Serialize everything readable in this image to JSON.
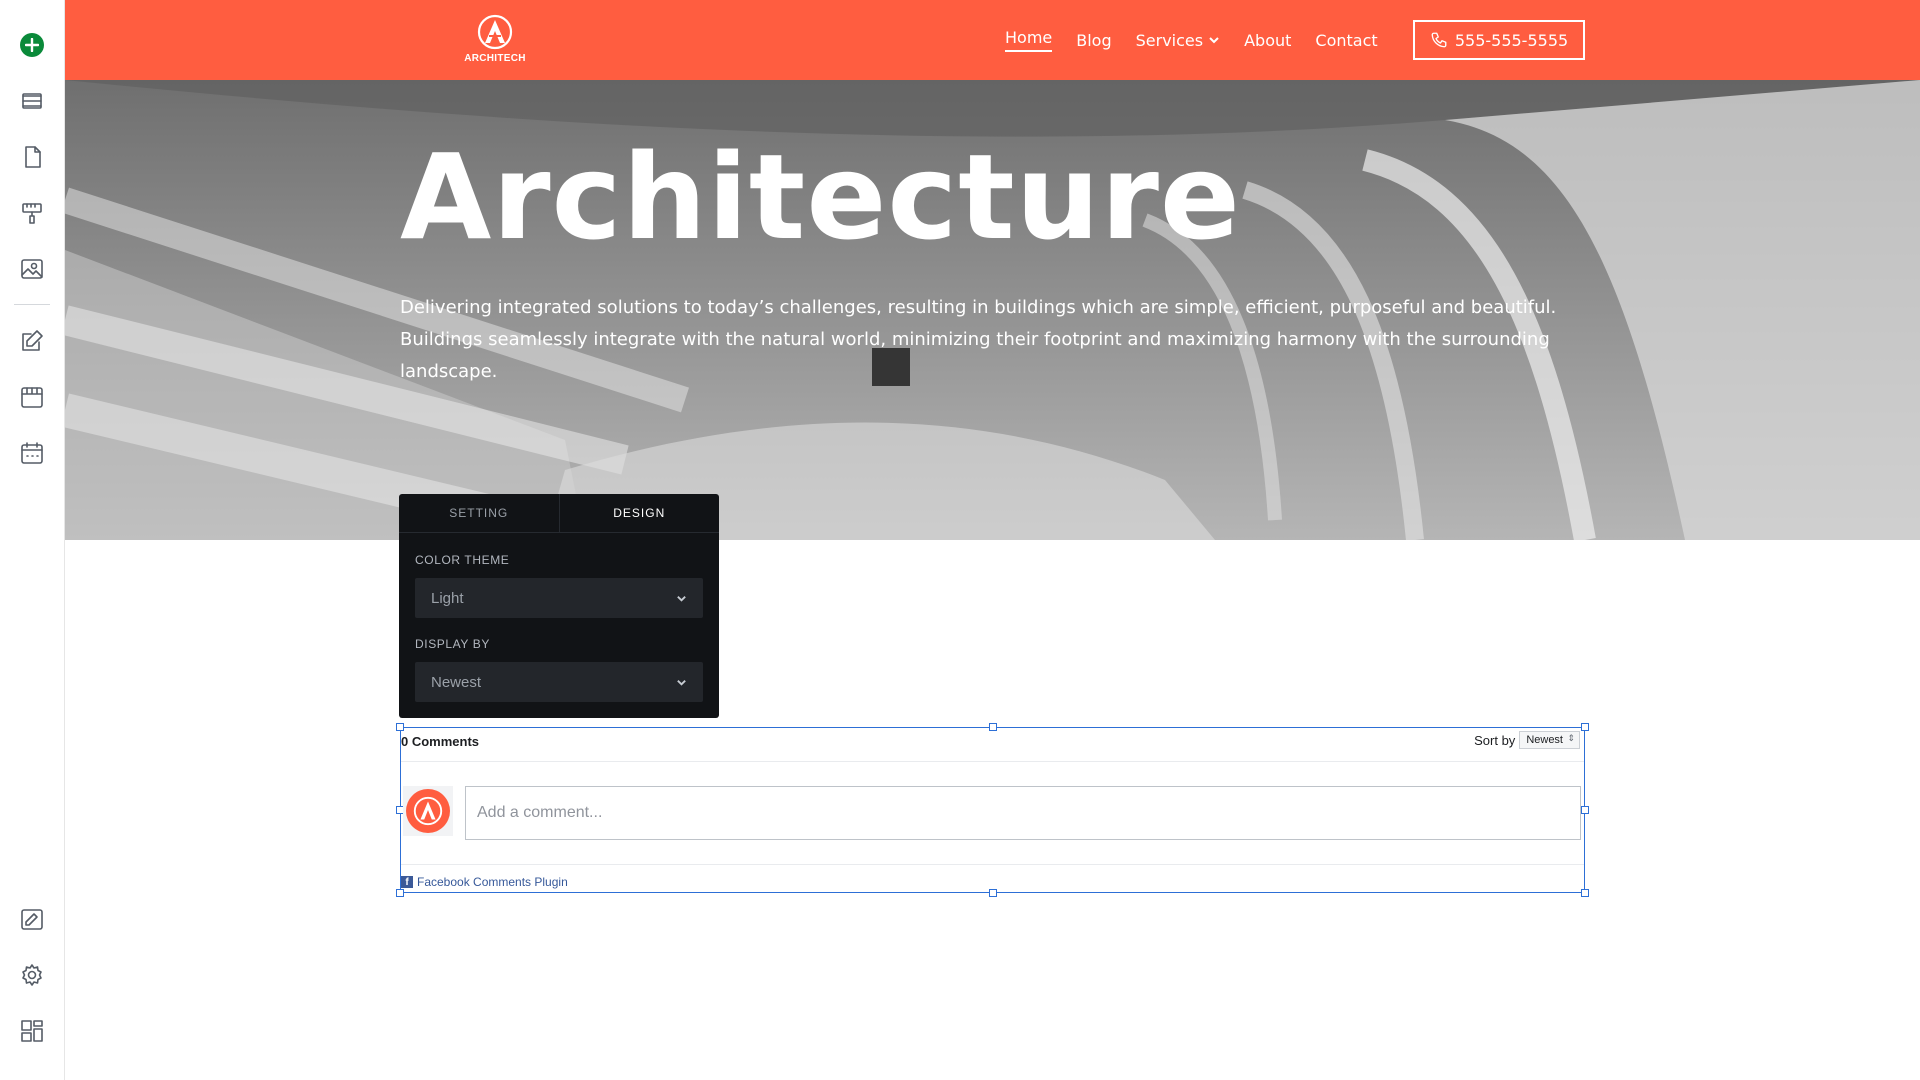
{
  "sidebar": {
    "items": [
      {
        "name": "add-icon"
      },
      {
        "name": "layers-icon"
      },
      {
        "name": "page-icon"
      },
      {
        "name": "paint-roller-icon"
      },
      {
        "name": "image-icon"
      },
      {
        "name": "blog-edit-icon"
      },
      {
        "name": "store-icon"
      },
      {
        "name": "calendar-icon"
      },
      {
        "name": "design-edit-icon"
      },
      {
        "name": "gear-icon"
      },
      {
        "name": "dashboard-icon"
      }
    ]
  },
  "header": {
    "logo_text": "ARCHITECH",
    "nav": [
      {
        "label": "Home",
        "active": true
      },
      {
        "label": "Blog"
      },
      {
        "label": "Services",
        "has_dropdown": true
      },
      {
        "label": "About"
      },
      {
        "label": "Contact"
      }
    ],
    "phone": "555-555-5555",
    "brand_color": "#ff5d40"
  },
  "hero": {
    "title": "Architecture",
    "text": "Delivering integrated solutions to today’s challenges, resulting in buildings which are simple, efficient, purposeful and beautiful. Buildings seamlessly integrate with the natural world, minimizing their footprint and maximizing harmony with the surrounding landscape."
  },
  "panel": {
    "tabs": [
      {
        "label": "SETTING"
      },
      {
        "label": "DESIGN",
        "active": true
      }
    ],
    "color_theme_label": "COLOR THEME",
    "color_theme_value": "Light",
    "display_by_label": "DISPLAY BY",
    "display_by_value": "Newest"
  },
  "comments": {
    "count": "0 Comments",
    "sort_label": "Sort by",
    "sort_value": "Newest",
    "placeholder": "Add a comment...",
    "plugin_label": "Facebook Comments Plugin",
    "accent_color": "#2d6fd6"
  }
}
